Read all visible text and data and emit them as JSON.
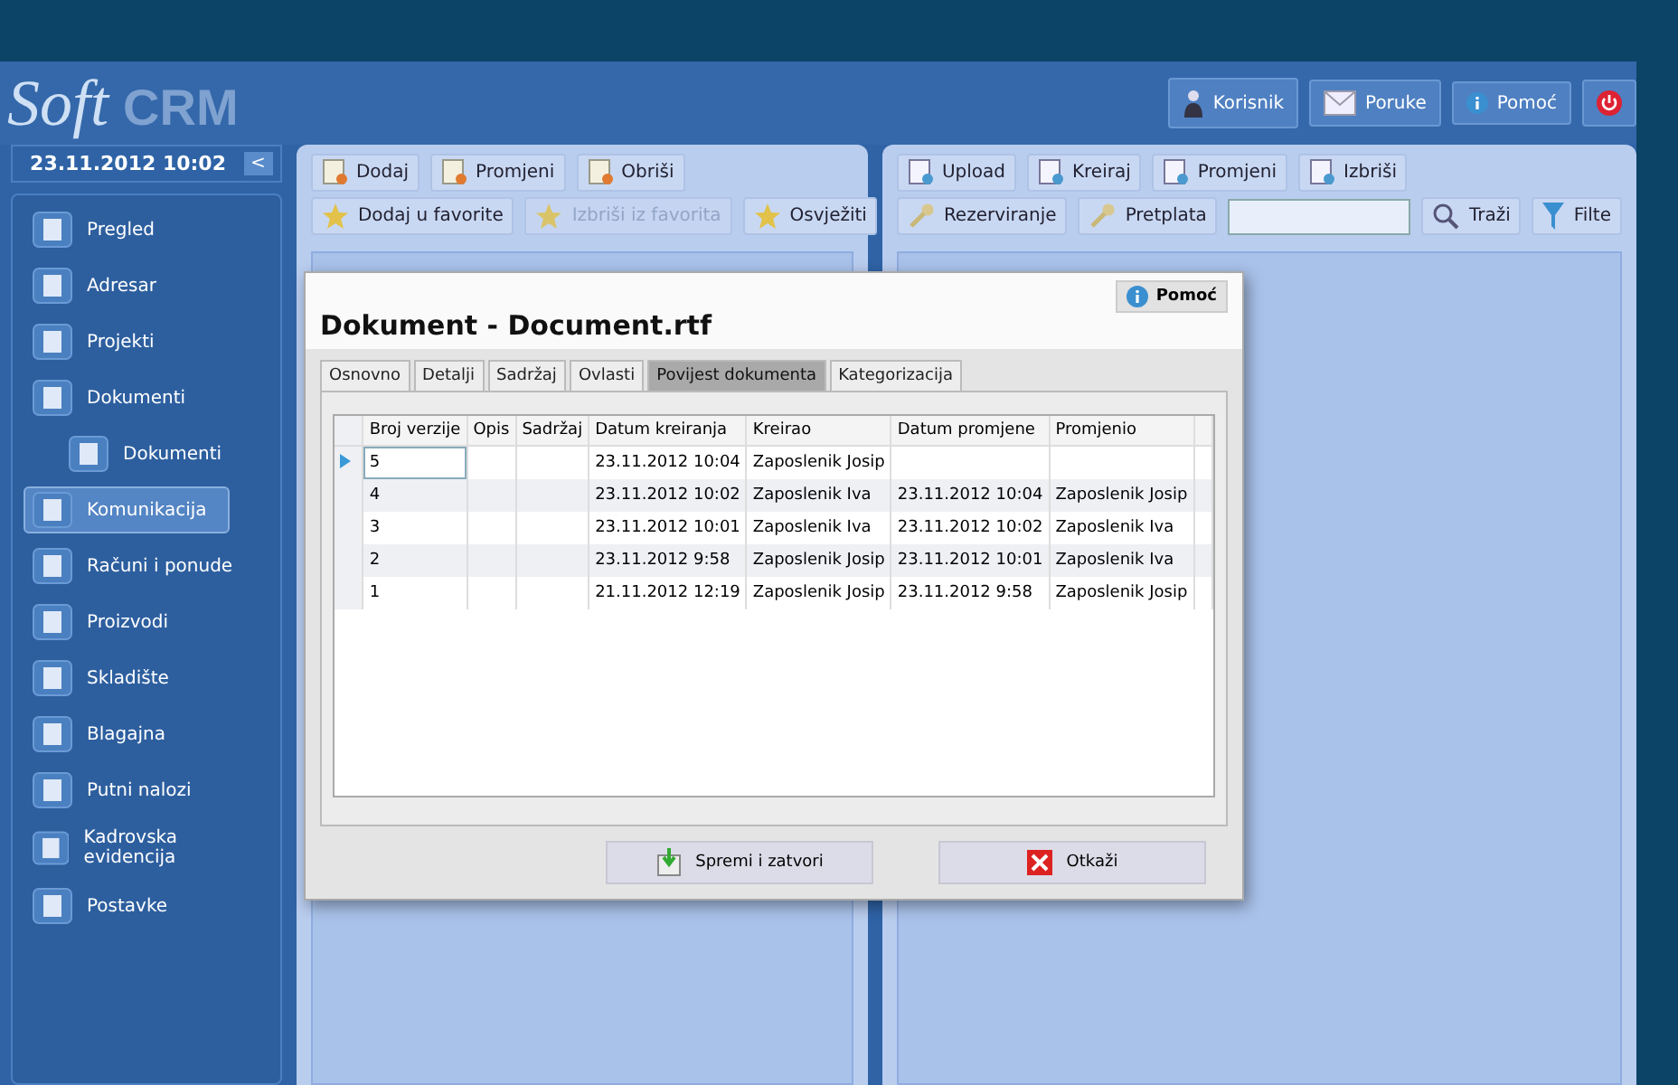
{
  "logo": {
    "soft": "Soft",
    "crm": "CRM"
  },
  "top_buttons": [
    {
      "label": "Korisnik",
      "kind": "user"
    },
    {
      "label": "Poruke",
      "kind": "mail"
    },
    {
      "label": "Pomoć",
      "kind": "info"
    },
    {
      "kind": "power"
    }
  ],
  "sidebar": {
    "date": "23.11.2012 10:02",
    "collapse": "<",
    "items": [
      {
        "label": "Pregled",
        "selected": false
      },
      {
        "label": "Adresar",
        "selected": false
      },
      {
        "label": "Projekti",
        "selected": false
      },
      {
        "label": "Dokumenti",
        "selected": false,
        "children": [
          {
            "label": "Dokumenti",
            "selected": false
          }
        ]
      },
      {
        "label": "Komunikacija",
        "selected": true
      },
      {
        "label": "Računi i ponude",
        "selected": false
      },
      {
        "label": "Proizvodi",
        "selected": false
      },
      {
        "label": "Skladište",
        "selected": false
      },
      {
        "label": "Blagajna",
        "selected": false
      },
      {
        "label": "Putni nalozi",
        "selected": false
      },
      {
        "label": "Kadrovska evidencija",
        "selected": false
      },
      {
        "label": "Postavke",
        "selected": false
      }
    ]
  },
  "middle_toolbar": {
    "row1": [
      {
        "label": "Dodaj",
        "disabled": false
      },
      {
        "label": "Promjeni",
        "disabled": false
      },
      {
        "label": "Obriši",
        "disabled": false
      }
    ],
    "row2": [
      {
        "label": "Dodaj u favorite",
        "disabled": false
      },
      {
        "label": "Izbriši iz favorita",
        "disabled": true
      },
      {
        "label": "Osvježiti",
        "disabled": false
      }
    ]
  },
  "right_toolbar": {
    "row1": [
      {
        "label": "Upload"
      },
      {
        "label": "Kreiraj"
      },
      {
        "label": "Promjeni"
      },
      {
        "label": "Izbriši"
      }
    ],
    "row2": [
      {
        "label": "Rezerviranje"
      },
      {
        "label": "Pretplata"
      }
    ],
    "search_button": "Traži",
    "filter_button": "Filte"
  },
  "dialog": {
    "title": "Dokument - Document.rtf",
    "help": "Pomoć",
    "tabs": [
      {
        "label": "Osnovno",
        "selected": false
      },
      {
        "label": "Detalji",
        "selected": false
      },
      {
        "label": "Sadržaj",
        "selected": false
      },
      {
        "label": "Ovlasti",
        "selected": false
      },
      {
        "label": "Povijest dokumenta",
        "selected": true
      },
      {
        "label": "Kategorizacija",
        "selected": false
      }
    ],
    "table": {
      "columns": [
        "Broj verzije",
        "Opis",
        "Sadržaj",
        "Datum kreiranja",
        "Kreirao",
        "Datum promjene",
        "Promjenio"
      ],
      "rows": [
        {
          "selected": true,
          "cells": [
            "5",
            null,
            null,
            "23.11.2012 10:04",
            "Zaposlenik Josip",
            null,
            null
          ]
        },
        {
          "selected": false,
          "cells": [
            "4",
            null,
            null,
            "23.11.2012 10:02",
            "Zaposlenik Iva",
            "23.11.2012 10:04",
            "Zaposlenik Josip"
          ]
        },
        {
          "selected": false,
          "cells": [
            "3",
            null,
            null,
            "23.11.2012 10:01",
            "Zaposlenik Iva",
            "23.11.2012 10:02",
            "Zaposlenik Iva"
          ]
        },
        {
          "selected": false,
          "cells": [
            "2",
            null,
            null,
            "23.11.2012 9:58",
            "Zaposlenik Josip",
            "23.11.2012 10:01",
            "Zaposlenik Iva"
          ]
        },
        {
          "selected": false,
          "cells": [
            "1",
            null,
            null,
            "21.11.2012 12:19",
            "Zaposlenik Josip",
            "23.11.2012 9:58",
            "Zaposlenik Josip"
          ]
        }
      ]
    },
    "buttons": [
      {
        "label": "Spremi i zatvori",
        "kind": "save"
      },
      {
        "label": "Otkaži",
        "kind": "cancel"
      }
    ]
  }
}
